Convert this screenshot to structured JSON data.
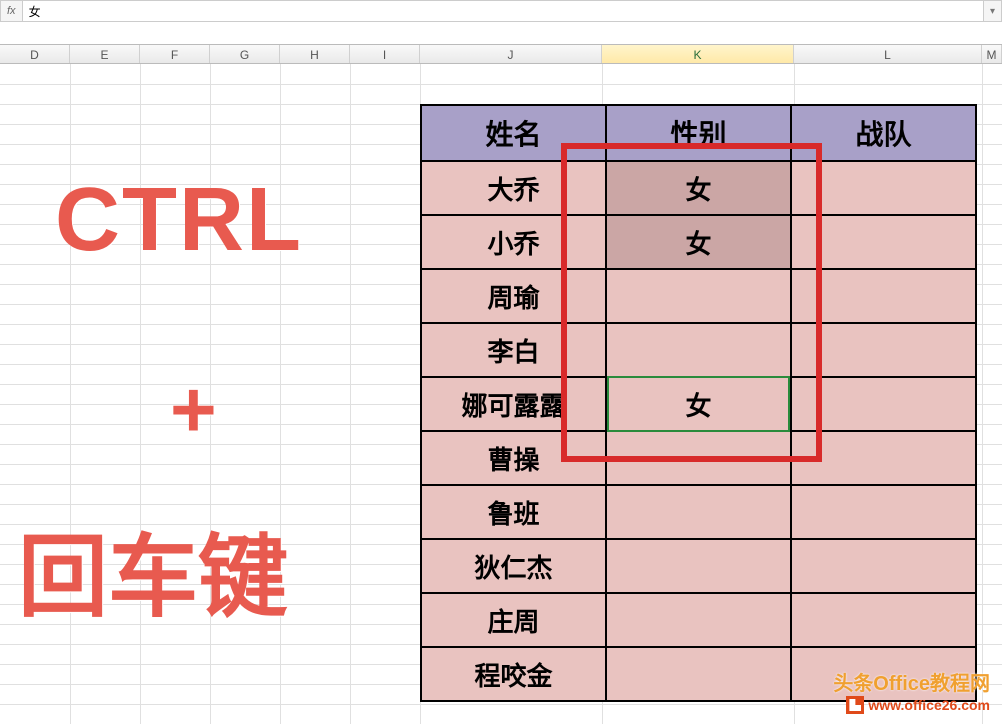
{
  "formula_bar": {
    "fx_label": "fx",
    "value": "女"
  },
  "columns": {
    "widths": [
      70,
      70,
      70,
      70,
      70,
      70,
      182,
      192,
      188,
      20
    ],
    "labels": [
      "D",
      "E",
      "F",
      "G",
      "H",
      "I",
      "J",
      "K",
      "L",
      "M"
    ],
    "active": "K"
  },
  "table": {
    "headers": {
      "name": "姓名",
      "gender": "性别",
      "team": "战队"
    },
    "rows": [
      {
        "name": "大乔",
        "gender": "女",
        "team": "",
        "sel": "a"
      },
      {
        "name": "小乔",
        "gender": "女",
        "team": "",
        "sel": "b"
      },
      {
        "name": "周瑜",
        "gender": "",
        "team": "",
        "sel": ""
      },
      {
        "name": "李白",
        "gender": "",
        "team": "",
        "sel": ""
      },
      {
        "name": "娜可露露",
        "gender": "女",
        "team": "",
        "sel": "active"
      },
      {
        "name": "曹操",
        "gender": "",
        "team": "",
        "sel": ""
      },
      {
        "name": "鲁班",
        "gender": "",
        "team": "",
        "sel": ""
      },
      {
        "name": "狄仁杰",
        "gender": "",
        "team": "",
        "sel": ""
      },
      {
        "name": "庄周",
        "gender": "",
        "team": "",
        "sel": ""
      },
      {
        "name": "程咬金",
        "gender": "",
        "team": "",
        "sel": ""
      }
    ]
  },
  "overlay": {
    "ctrl": "CTRL",
    "plus": "+",
    "enter": "回车键"
  },
  "watermark": {
    "line1": "头条Office教程网",
    "line2": "www.office26.com"
  }
}
